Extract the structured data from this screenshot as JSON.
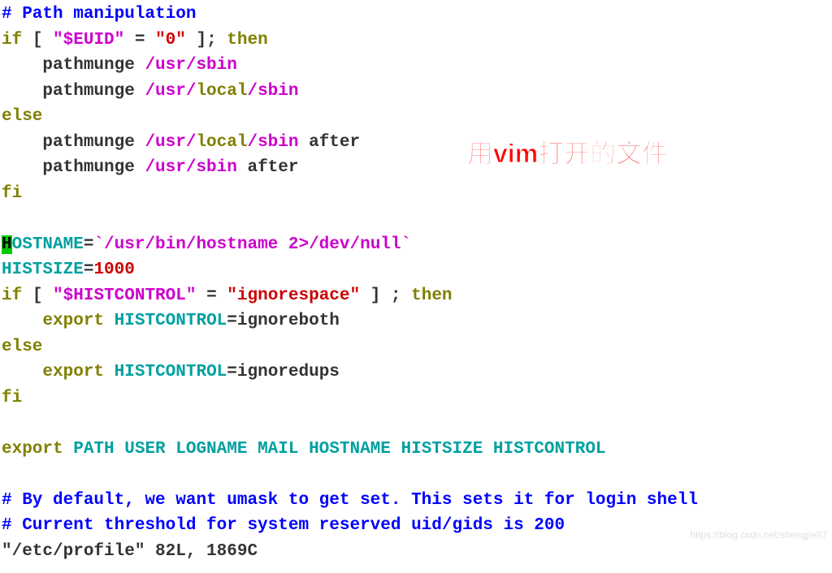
{
  "code": {
    "l1_comment": "# Path manipulation",
    "l2_if": "if",
    "l2_bracket1": " [ ",
    "l2_var": "\"$EUID\"",
    "l2_eq": " = ",
    "l2_val": "\"0\"",
    "l2_bracket2": " ]; ",
    "l2_then": "then",
    "l3_a": "    pathmunge ",
    "l3_b": "/usr/sbin",
    "l4_a": "    pathmunge ",
    "l4_b": "/usr/",
    "l4_c": "local",
    "l4_d": "/sbin",
    "l5_else": "else",
    "l6_a": "    pathmunge ",
    "l6_b": "/usr/",
    "l6_c": "local",
    "l6_d": "/sbin",
    "l6_e": " after",
    "l7_a": "    pathmunge ",
    "l7_b": "/usr/sbin",
    "l7_c": " after",
    "l8_fi": "fi",
    "l10_cursor": "H",
    "l10_var": "OSTNAME",
    "l10_eq": "=",
    "l10_val": "`/usr/bin/hostname 2>/dev/null`",
    "l11_var": "HISTSIZE",
    "l11_eq": "=",
    "l11_val": "1000",
    "l12_if": "if",
    "l12_bracket1": " [ ",
    "l12_var": "\"$HISTCONTROL\"",
    "l12_eq": " = ",
    "l12_val": "\"ignorespace\"",
    "l12_bracket2": " ] ; ",
    "l12_then": "then",
    "l13_a": "    ",
    "l13_b": "export",
    "l13_c": " ",
    "l13_d": "HISTCONTROL",
    "l13_e": "=ignoreboth",
    "l14_else": "else",
    "l15_a": "    ",
    "l15_b": "export",
    "l15_c": " ",
    "l15_d": "HISTCONTROL",
    "l15_e": "=ignoredups",
    "l16_fi": "fi",
    "l18_a": "export",
    "l18_b": " PATH USER LOGNAME MAIL HOSTNAME HISTSIZE HISTCONTROL",
    "l20": "# By default, we want umask to get set. This sets it for login shell",
    "l21": "# Current threshold for system reserved uid/gids is 200",
    "l22": "\"/etc/profile\" 82L, 1869C"
  },
  "annotation": "用vim打开的文件",
  "watermark": "https://blog.csdn.net/shengjie87"
}
